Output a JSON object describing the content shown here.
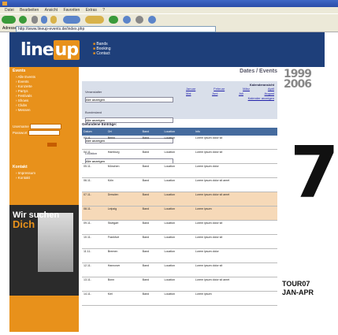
{
  "browser": {
    "menus": [
      "Datei",
      "Bearbeiten",
      "Ansicht",
      "Favoriten",
      "Extras",
      "?"
    ],
    "address_label": "Adresse",
    "address_value": "http://www.lineup-events.de/index.php"
  },
  "header": {
    "logo_main": "line",
    "logo_accent": "up",
    "nav": [
      "Bands",
      "Booking",
      "Contact"
    ]
  },
  "left": {
    "section_events": "Events",
    "event_items": [
      "Alle Events",
      "Events",
      "Konzerte",
      "Partys",
      "Festivals",
      "Shows",
      "Clubs",
      "Messen"
    ],
    "form_label_user": "Username",
    "form_label_pass": "Passwort",
    "section_contact": "Kontakt",
    "contact_items": [
      "Impressum",
      "Kontakt"
    ],
    "banner_line1": "Wir suchen",
    "banner_line2": "Dich"
  },
  "main": {
    "title": "Dates / Events",
    "filter_labels": [
      "Veranstalter",
      "Bundesland",
      "Stadt",
      "Location",
      "Art"
    ],
    "filter_values": [
      "Alle anzeigen",
      "Alle anzeigen",
      "Alle anzeigen",
      "Alle anzeigen",
      "Alle anzeigen"
    ],
    "kalender_title": "Kalenderansicht",
    "kalender_row1": [
      "Januar",
      "Februar",
      "März",
      "April"
    ],
    "kalender_row2": [
      "Mai",
      "Juni",
      "Juli",
      "August"
    ],
    "kalender_link": "Kalender anzeigen",
    "found_label": "Gefundene Einträge:",
    "table_headers": [
      "Datum",
      "Ort",
      "Band",
      "Location",
      "Info"
    ],
    "rows": [
      [
        "03.11.",
        "Berlin",
        "Band",
        "Location",
        "Lorem ipsum dolor sit"
      ],
      [
        "04.11.",
        "Hamburg",
        "Band",
        "Location",
        "Lorem ipsum dolor sit"
      ],
      [
        "05.11.",
        "München",
        "Band",
        "Location",
        "Lorem ipsum dolor"
      ],
      [
        "06.11.",
        "Köln",
        "Band",
        "Location",
        "Lorem ipsum dolor sit amet"
      ],
      [
        "07.11.",
        "Dresden",
        "Band",
        "Location",
        "Lorem ipsum dolor sit amet"
      ],
      [
        "08.11.",
        "Leipzig",
        "Band",
        "Location",
        "Lorem ipsum"
      ],
      [
        "09.11.",
        "Stuttgart",
        "Band",
        "Location",
        "Lorem ipsum dolor sit"
      ],
      [
        "10.11.",
        "Frankfurt",
        "Band",
        "Location",
        "Lorem ipsum dolor sit"
      ],
      [
        "11.11.",
        "Bremen",
        "Band",
        "Location",
        "Lorem ipsum dolor"
      ],
      [
        "12.11.",
        "Hannover",
        "Band",
        "Location",
        "Lorem ipsum dolor sit"
      ],
      [
        "13.11.",
        "Bonn",
        "Band",
        "Location",
        "Lorem ipsum dolor sit amet"
      ],
      [
        "14.11.",
        "Kiel",
        "Band",
        "Location",
        "Lorem ipsum"
      ]
    ]
  },
  "right": {
    "year_top": "1999",
    "year_bottom": "2006",
    "poster_number": "7",
    "tour": "TOUR07",
    "tour_dates": "JAN-APR"
  },
  "colors": {
    "orange": "#e8911b",
    "navy": "#1e3f7a",
    "highlight": "#f6d9b8"
  }
}
